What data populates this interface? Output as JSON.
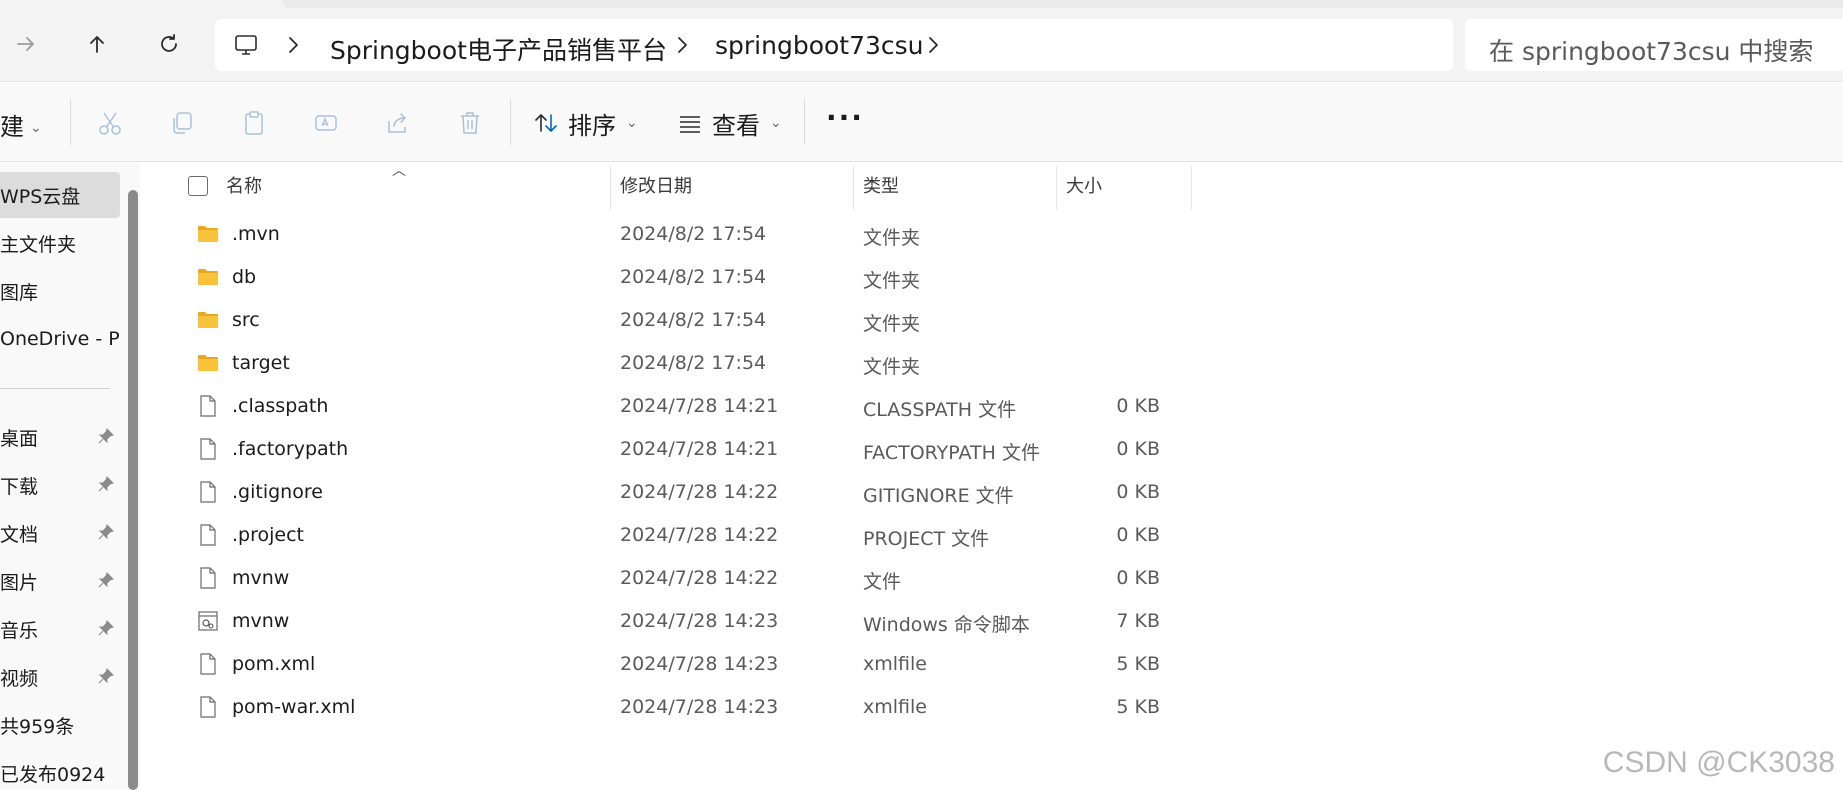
{
  "address_bar": {
    "breadcrumbs": [
      "Springboot电子产品销售平台",
      "springboot73csu"
    ],
    "search_placeholder": "在 springboot73csu 中搜索"
  },
  "toolbar": {
    "new_label": "建",
    "sort_label": "排序",
    "view_label": "查看",
    "more_label": "···"
  },
  "sidebar": {
    "items": [
      {
        "label": "WPS云盘",
        "pinned": false
      },
      {
        "label": "主文件夹",
        "pinned": false
      },
      {
        "label": "图库",
        "pinned": false
      },
      {
        "label": "OneDrive - Per",
        "pinned": false
      },
      {
        "label": "桌面",
        "pinned": true
      },
      {
        "label": "下载",
        "pinned": true
      },
      {
        "label": "文档",
        "pinned": true
      },
      {
        "label": "图片",
        "pinned": true
      },
      {
        "label": "音乐",
        "pinned": true
      },
      {
        "label": "视频",
        "pinned": true
      },
      {
        "label": "共959条",
        "pinned": false
      },
      {
        "label": "已发布0924",
        "pinned": false
      }
    ]
  },
  "columns": {
    "name": "名称",
    "modified": "修改日期",
    "type": "类型",
    "size": "大小"
  },
  "files": [
    {
      "name": ".mvn",
      "modified": "2024/8/2 17:54",
      "type": "文件夹",
      "size": "",
      "icon": "folder"
    },
    {
      "name": "db",
      "modified": "2024/8/2 17:54",
      "type": "文件夹",
      "size": "",
      "icon": "folder"
    },
    {
      "name": "src",
      "modified": "2024/8/2 17:54",
      "type": "文件夹",
      "size": "",
      "icon": "folder"
    },
    {
      "name": "target",
      "modified": "2024/8/2 17:54",
      "type": "文件夹",
      "size": "",
      "icon": "folder"
    },
    {
      "name": ".classpath",
      "modified": "2024/7/28 14:21",
      "type": "CLASSPATH 文件",
      "size": "0 KB",
      "icon": "file"
    },
    {
      "name": ".factorypath",
      "modified": "2024/7/28 14:21",
      "type": "FACTORYPATH 文件",
      "size": "0 KB",
      "icon": "file"
    },
    {
      "name": ".gitignore",
      "modified": "2024/7/28 14:22",
      "type": "GITIGNORE 文件",
      "size": "0 KB",
      "icon": "file"
    },
    {
      "name": ".project",
      "modified": "2024/7/28 14:22",
      "type": "PROJECT 文件",
      "size": "0 KB",
      "icon": "file"
    },
    {
      "name": "mvnw",
      "modified": "2024/7/28 14:22",
      "type": "文件",
      "size": "0 KB",
      "icon": "file"
    },
    {
      "name": "mvnw",
      "modified": "2024/7/28 14:23",
      "type": "Windows 命令脚本",
      "size": "7 KB",
      "icon": "script"
    },
    {
      "name": "pom.xml",
      "modified": "2024/7/28 14:23",
      "type": "xmlfile",
      "size": "5 KB",
      "icon": "file"
    },
    {
      "name": "pom-war.xml",
      "modified": "2024/7/28 14:23",
      "type": "xmlfile",
      "size": "5 KB",
      "icon": "file"
    }
  ],
  "watermark": "CSDN @CK3038",
  "colors": {
    "folder": "#f8c33a",
    "folder_back": "#e8a820",
    "accent": "#0067c0"
  }
}
